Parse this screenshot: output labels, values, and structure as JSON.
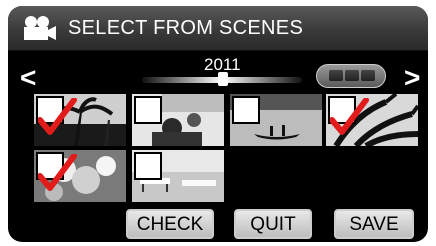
{
  "header": {
    "title": "SELECT FROM SCENES",
    "icon": "video-camera-icon"
  },
  "navigation": {
    "prev_label": "<",
    "next_label": ">",
    "year": "2011"
  },
  "thumbnails": [
    {
      "checked": true,
      "scene": "palm trees silhouette"
    },
    {
      "checked": false,
      "scene": "person with child"
    },
    {
      "checked": false,
      "scene": "canoe on water"
    },
    {
      "checked": true,
      "scene": "palm leaves"
    },
    {
      "checked": true,
      "scene": "flowers close-up"
    },
    {
      "checked": false,
      "scene": "beach with chairs"
    }
  ],
  "buttons": {
    "check": "CHECK",
    "quit": "QUIT",
    "save": "SAVE"
  },
  "colors": {
    "check_red": "#e21b1b",
    "background": "#000000"
  }
}
